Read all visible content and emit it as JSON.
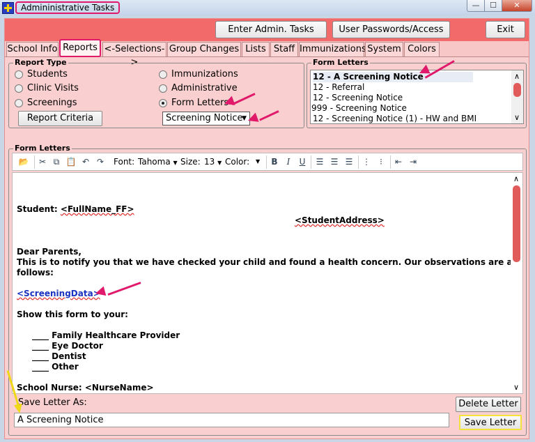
{
  "window": {
    "title": "Admininistrative Tasks",
    "minimize_glyph": "—",
    "maximize_glyph": "☐",
    "close_glyph": "✕"
  },
  "top_buttons": {
    "enter_admin": "Enter Admin. Tasks",
    "user_passwords": "User Passwords/Access",
    "exit": "Exit"
  },
  "tabs": [
    {
      "label": "School Info"
    },
    {
      "label": "Reports"
    },
    {
      "label": "<-Selections->"
    },
    {
      "label": "Group Changes"
    },
    {
      "label": "Lists"
    },
    {
      "label": "Staff"
    },
    {
      "label": "Immunizations"
    },
    {
      "label": "System"
    },
    {
      "label": "Colors"
    }
  ],
  "report_type": {
    "title": "Report Type",
    "options": [
      {
        "label": "Students",
        "selected": false
      },
      {
        "label": "Clinic Visits",
        "selected": false
      },
      {
        "label": "Screenings",
        "selected": false
      },
      {
        "label": "Immunizations",
        "selected": false
      },
      {
        "label": "Administrative",
        "selected": false
      },
      {
        "label": "Form Letters",
        "selected": true
      }
    ],
    "criteria_button": "Report Criteria",
    "letter_select_value": "Screening Notice"
  },
  "form_letters_list": {
    "title": "Form Letters",
    "items": [
      "12 - A Screening Notice",
      "12 - Referral",
      "12 - Screening Notice",
      "999 - Screening Notice",
      "12 - Screening Notice (1) - HW and BMI"
    ],
    "selected_index": 0
  },
  "editor": {
    "group_title": "Form Letters",
    "font_label": "Font:",
    "font_value": "Tahoma",
    "size_label": "Size:",
    "size_value": "13",
    "color_label": "Color:",
    "lines": {
      "student": "Student: ",
      "student_tag": "<FullName_FF>",
      "address_tag": "<StudentAddress>",
      "dear": "Dear Parents,",
      "notify1": "This is to notify you that we have checked your child and found a health concern.  Our observations are as",
      "notify2": "follows:",
      "screening_tag": "<ScreeningData>",
      "show": "Show this form to your:",
      "item1": "____ Family Healthcare Provider",
      "item2": "____ Eye Doctor",
      "item3": "____ Dentist",
      "item4": "____ Other",
      "nurse": "School Nurse: ",
      "nurse_tag": "<NurseName>"
    }
  },
  "save": {
    "label": "Save Letter As:",
    "value": "A Screening Notice",
    "delete_button": "Delete Letter",
    "save_button": "Save Letter"
  },
  "colors": {
    "frame": "#f7c6c6",
    "top_strip": "#f26a6a",
    "annotation": "#e0196b",
    "highlight": "#f0d818"
  }
}
